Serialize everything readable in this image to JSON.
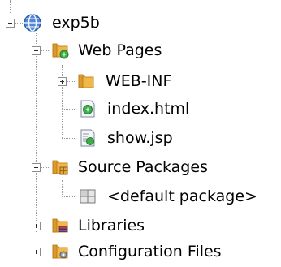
{
  "tree": {
    "project": {
      "label": "exp5b",
      "icon": "globe-project-icon"
    },
    "web_pages": {
      "label": "Web Pages",
      "icon": "web-folder-icon"
    },
    "web_inf": {
      "label": "WEB-INF",
      "icon": "folder-icon"
    },
    "index_html": {
      "label": "index.html",
      "icon": "html-file-icon"
    },
    "show_jsp": {
      "label": "show.jsp",
      "icon": "jsp-file-icon"
    },
    "source_packages": {
      "label": "Source Packages",
      "icon": "source-packages-icon"
    },
    "default_package": {
      "label": "<default package>",
      "icon": "package-icon"
    },
    "libraries": {
      "label": "Libraries",
      "icon": "libraries-icon"
    },
    "configuration_files": {
      "label": "Configuration Files",
      "icon": "config-files-icon"
    }
  },
  "colors": {
    "folder": "#f0b84a",
    "folder_dark": "#c98a1f",
    "globe": "#3c73c4",
    "badge_green": "#3cae48"
  }
}
